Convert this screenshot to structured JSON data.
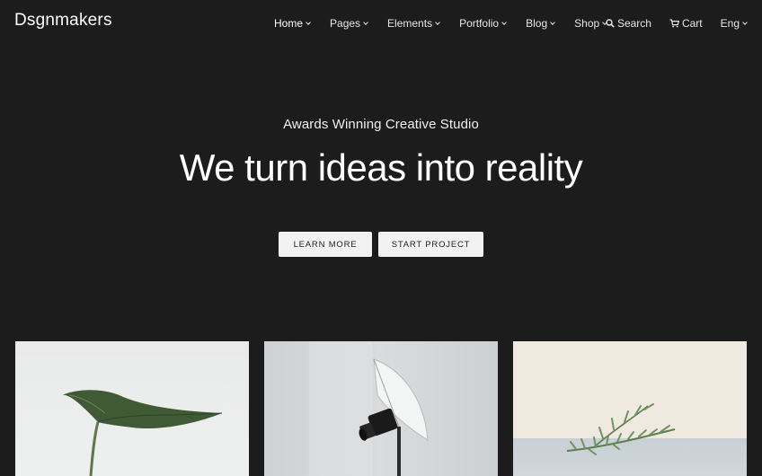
{
  "brand": {
    "logo_text": "Dsgnmakers"
  },
  "nav": {
    "items": [
      {
        "label": "Home",
        "active": true
      },
      {
        "label": "Pages",
        "active": false
      },
      {
        "label": "Elements",
        "active": false
      },
      {
        "label": "Portfolio",
        "active": false
      },
      {
        "label": "Blog",
        "active": false
      },
      {
        "label": "Shop",
        "active": false
      }
    ]
  },
  "tools": {
    "search_label": "Search",
    "cart_label": "Cart",
    "language_label": "Eng"
  },
  "hero": {
    "kicker": "Awards Winning Creative Studio",
    "headline": "We turn ideas into reality",
    "learn_more_label": "LEARN MORE",
    "start_project_label": "START PROJECT"
  },
  "colors": {
    "background": "#1c1c1c",
    "button_bg": "#f2f2f2",
    "button_text": "#222222"
  },
  "portfolio": {
    "cards": [
      {
        "image_icon": "leaf-image"
      },
      {
        "image_icon": "studio-umbrella-light-image"
      },
      {
        "image_icon": "rosemary-sprig-image"
      }
    ]
  }
}
